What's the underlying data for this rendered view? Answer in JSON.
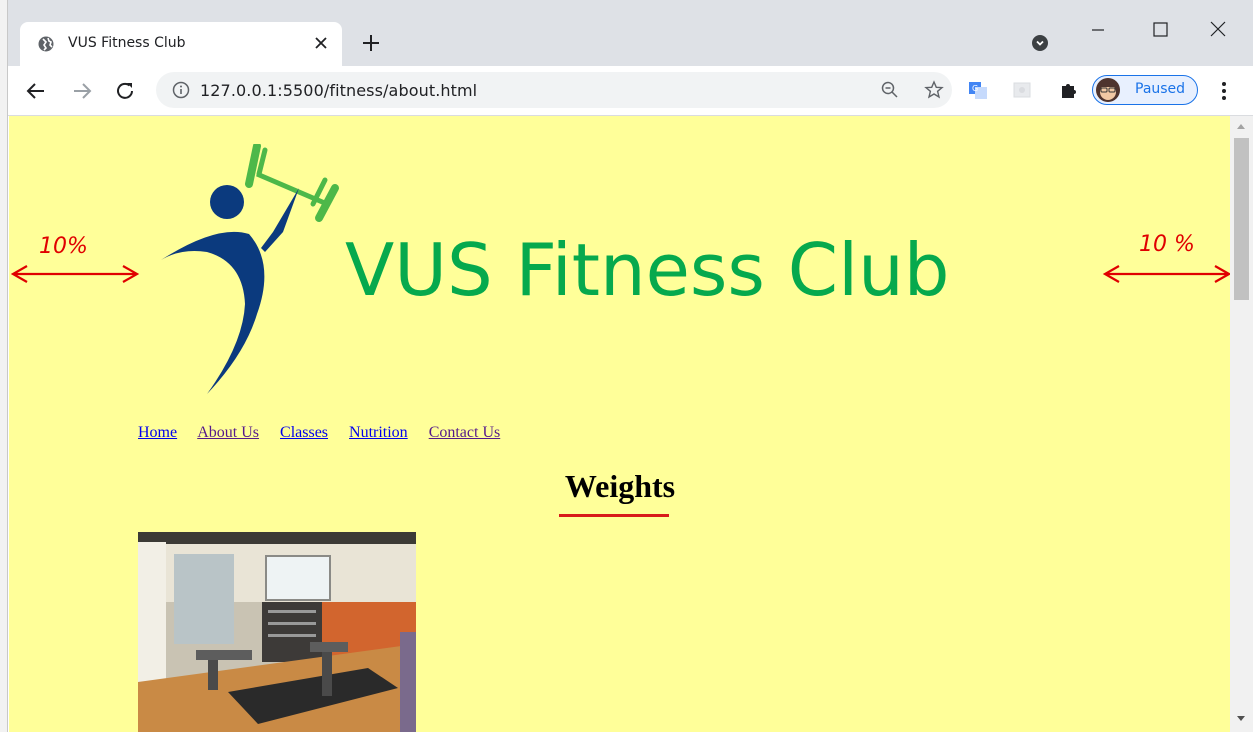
{
  "browser": {
    "tab_title": "VUS Fitness Club",
    "url": "127.0.0.1:5500/fitness/about.html",
    "profile_label": "Paused"
  },
  "icons": [
    "globe-icon",
    "close-icon",
    "plus-icon",
    "back-icon",
    "forward-icon",
    "reload-icon",
    "info-icon",
    "zoom-icon",
    "star-icon",
    "translate-icon",
    "extension-icon",
    "puzzle-icon",
    "menu-icon"
  ],
  "page": {
    "site_title": "VUS Fitness Club",
    "nav": [
      {
        "label": "Home",
        "visited": false
      },
      {
        "label": "About Us",
        "visited": true
      },
      {
        "label": "Classes",
        "visited": false
      },
      {
        "label": "Nutrition",
        "visited": false
      },
      {
        "label": "Contact Us",
        "visited": true
      }
    ],
    "heading": "Weights",
    "annotations": {
      "left": "10%",
      "right": "10 %"
    }
  },
  "colors": {
    "page_bg": "#ffff99",
    "title_green": "#06a94d",
    "logo_blue": "#0b3a7e",
    "annotation_red": "#e00000",
    "underline_red": "#d81b1b"
  }
}
